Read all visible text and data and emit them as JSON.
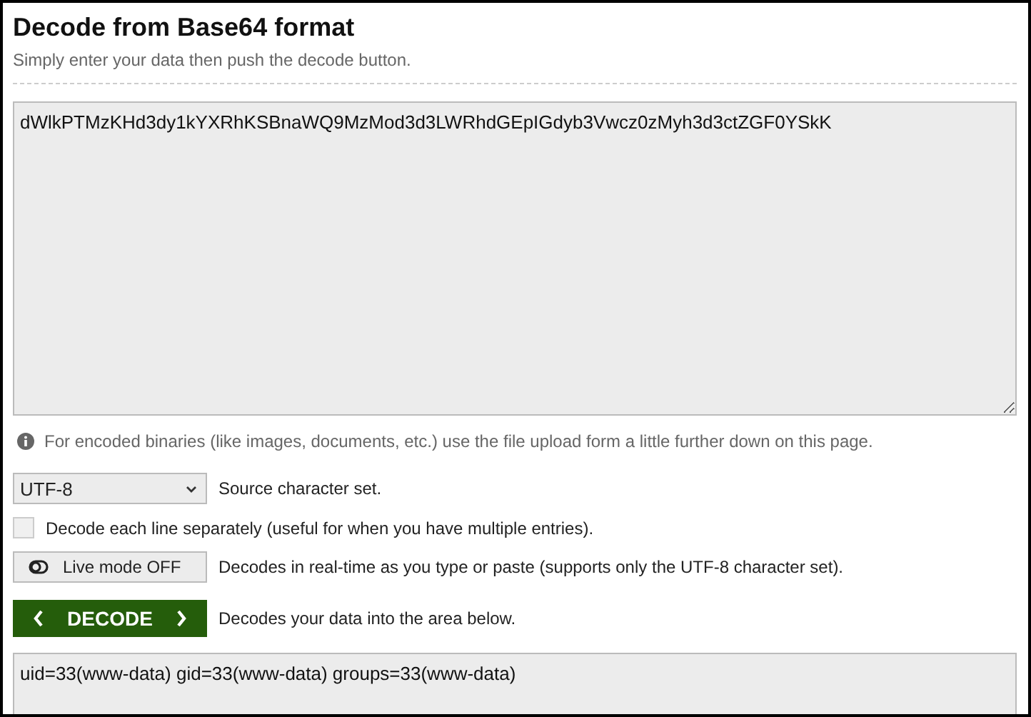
{
  "title": "Decode from Base64 format",
  "subtitle": "Simply enter your data then push the decode button.",
  "input": {
    "value": "dWlkPTMzKHd3dy1kYXRhKSBnaWQ9MzMod3d3LWRhdGEpIGdyb3Vwcz0zMyh3d3ctZGF0YSkK"
  },
  "info": "For encoded binaries (like images, documents, etc.) use the file upload form a little further down on this page.",
  "options": [
    {
      "kind": "select",
      "charset": "UTF-8",
      "label": "Source character set."
    },
    {
      "kind": "checkbox",
      "checked": false,
      "label": "Decode each line separately (useful for when you have multiple entries)."
    },
    {
      "kind": "toggle",
      "on": false,
      "button": "Live mode OFF",
      "label": "Decodes in real-time as you type or paste (supports only the UTF-8 character set)."
    },
    {
      "kind": "action",
      "button": "DECODE",
      "label": "Decodes your data into the area below."
    }
  ],
  "output": {
    "value": "uid=33(www-data) gid=33(www-data) groups=33(www-data)"
  }
}
